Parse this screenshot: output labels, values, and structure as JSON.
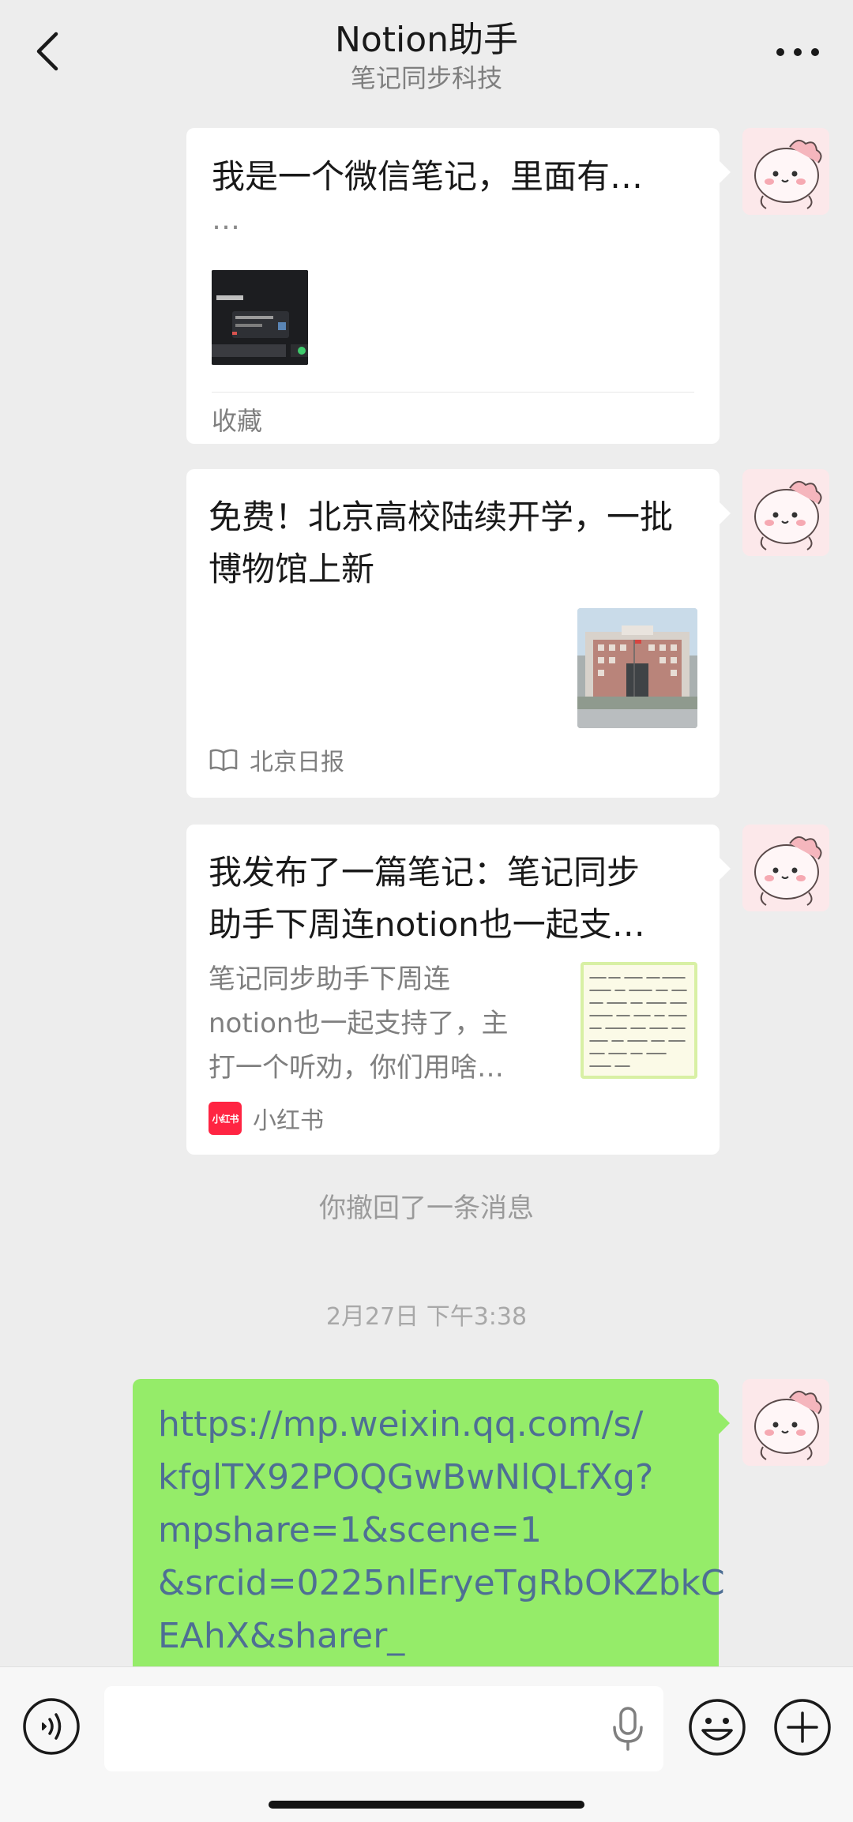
{
  "header": {
    "title": "Notion助手",
    "subtitle": "笔记同步科技"
  },
  "messages": {
    "card1": {
      "title": "我是一个微信笔记，里面有…",
      "ellipsis": "…",
      "source": "收藏"
    },
    "card2": {
      "title": "免费！北京高校陆续开学，一批博物馆上新",
      "source": "北京日报"
    },
    "card3": {
      "title_line1": "我发布了一篇笔记：笔记同步",
      "title_line2": "助手下周连notion也一起支…",
      "desc_line1": "笔记同步助手下周连",
      "desc_line2": "notion也一起支持了，主",
      "desc_line3": "打一个听劝，你们用啥…",
      "logo_text": "小红书",
      "source": "小红书"
    },
    "system_text": "你撤回了一条消息",
    "timestamp": "2月27日 下午3:38",
    "link_message": {
      "line1": "https://mp.weixin.qq.com/s/",
      "line2": "kfglTX92POQGwBwNlQLfXg?",
      "line3": "mpshare=1&scene=1",
      "line4": "&srcid=0225nlEryeTgRbOKZbkC",
      "line5": "EAhX&sharer_"
    }
  },
  "input": {
    "value": "",
    "placeholder": ""
  },
  "colors": {
    "background": "#ededed",
    "bubble_green": "#95ec69",
    "link_text": "#4e6f94",
    "card_bg": "#ffffff",
    "xhs_red": "#ff2442"
  }
}
